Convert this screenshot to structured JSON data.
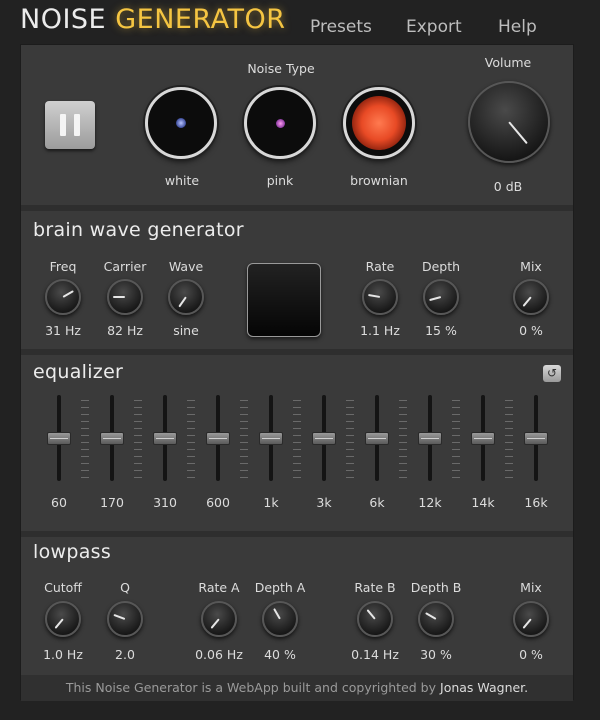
{
  "header": {
    "title_part1": "NOISE",
    "title_part2": "GENERATOR",
    "nav": [
      "Presets",
      "Export",
      "Help"
    ]
  },
  "top": {
    "noise_type_label": "Noise Type",
    "noise_types": [
      "white",
      "pink",
      "brownian"
    ],
    "selected_noise_type": "brownian",
    "volume": {
      "label": "Volume",
      "value": "0 dB"
    },
    "pause_icon": "pause-icon"
  },
  "brainwave": {
    "title": "brain wave generator",
    "knobs": [
      {
        "label": "Freq",
        "value": "31 Hz"
      },
      {
        "label": "Carrier",
        "value": "82 Hz"
      },
      {
        "label": "Wave",
        "value": "sine"
      },
      {
        "label": "Rate",
        "value": "1.1 Hz"
      },
      {
        "label": "Depth",
        "value": "15 %"
      },
      {
        "label": "Mix",
        "value": "0 %"
      }
    ]
  },
  "equalizer": {
    "title": "equalizer",
    "reset_icon": "reset-icon",
    "reset_glyph": "↺",
    "bands": [
      "60",
      "170",
      "310",
      "600",
      "1k",
      "3k",
      "6k",
      "12k",
      "14k",
      "16k"
    ]
  },
  "lowpass": {
    "title": "lowpass",
    "knobs": [
      {
        "label": "Cutoff",
        "value": "1.0 Hz"
      },
      {
        "label": "Q",
        "value": "2.0"
      },
      {
        "label": "Rate A",
        "value": "0.06 Hz"
      },
      {
        "label": "Depth A",
        "value": "40 %"
      },
      {
        "label": "Rate B",
        "value": "0.14 Hz"
      },
      {
        "label": "Depth B",
        "value": "30 %"
      },
      {
        "label": "Mix",
        "value": "0 %"
      }
    ]
  },
  "footer": {
    "text": "This Noise Generator is a WebApp built and copyrighted by",
    "author": "Jonas Wagner."
  },
  "colors": {
    "accent": "#f5c542",
    "background": "#222222",
    "panel": "#3a3a3a"
  }
}
